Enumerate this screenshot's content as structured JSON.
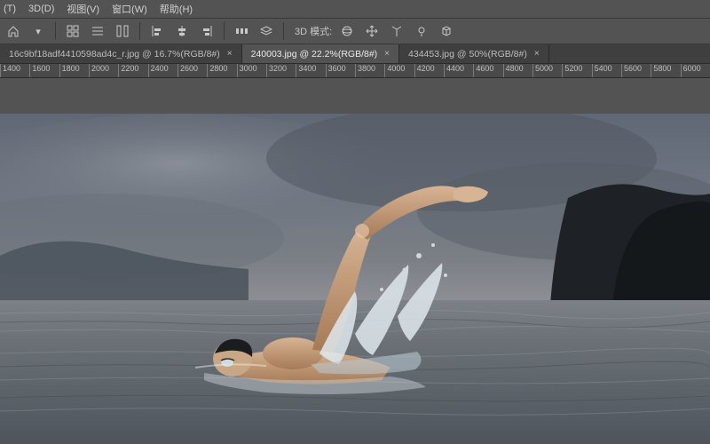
{
  "menu": {
    "items": [
      "(T)",
      "3D(D)",
      "视图(V)",
      "窗口(W)",
      "帮助(H)"
    ]
  },
  "options_bar": {
    "mode_label": "3D 模式:"
  },
  "tabs": [
    {
      "label": "16c9bf18adf4410598ad4c_r.jpg @ 16.7%(RGB/8#)",
      "active": false
    },
    {
      "label": "240003.jpg @ 22.2%(RGB/8#)",
      "active": true
    },
    {
      "label": "434453.jpg @ 50%(RGB/8#)",
      "active": false
    }
  ],
  "ruler": {
    "start": 1400,
    "end": 6200,
    "step": 200
  },
  "colors": {
    "ui_bg": "#535353",
    "ui_dark": "#3f3f3f",
    "text": "#d0d0d0"
  }
}
